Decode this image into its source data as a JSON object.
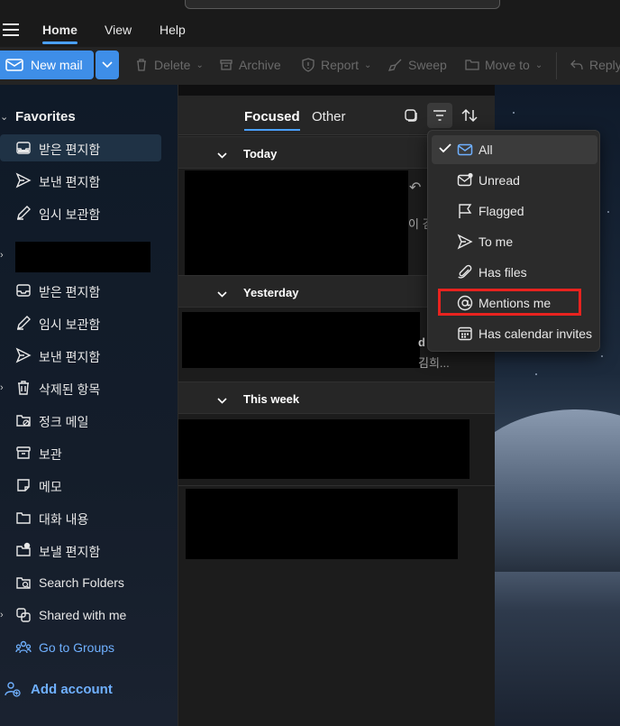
{
  "menubar": {
    "tabs": [
      {
        "label": "Home",
        "active": true
      },
      {
        "label": "View",
        "active": false
      },
      {
        "label": "Help",
        "active": false
      }
    ]
  },
  "toolbar": {
    "new_mail": "New mail",
    "delete": "Delete",
    "archive": "Archive",
    "report": "Report",
    "sweep": "Sweep",
    "move_to": "Move to",
    "reply": "Reply"
  },
  "sidebar": {
    "favorites_header": "Favorites",
    "favorites": [
      {
        "label": "받은 편지함",
        "icon": "inbox-icon",
        "selected": true
      },
      {
        "label": "보낸 편지함",
        "icon": "send-icon"
      },
      {
        "label": "임시 보관함",
        "icon": "draft-icon"
      }
    ],
    "account_folders": [
      {
        "label": "받은 편지함",
        "icon": "inbox-icon"
      },
      {
        "label": "임시 보관함",
        "icon": "draft-icon"
      },
      {
        "label": "보낸 편지함",
        "icon": "send-icon"
      },
      {
        "label": "삭제된 항목",
        "icon": "trash-icon"
      },
      {
        "label": "정크 메일",
        "icon": "junk-icon"
      },
      {
        "label": "보관",
        "icon": "archive-icon"
      },
      {
        "label": "메모",
        "icon": "note-icon"
      },
      {
        "label": "대화 내용",
        "icon": "folder-icon"
      },
      {
        "label": "보낼 편지함",
        "icon": "outbox-icon"
      },
      {
        "label": "Search Folders",
        "icon": "search-folder-icon"
      },
      {
        "label": "Shared with me",
        "icon": "shared-icon"
      },
      {
        "label": "Go to Groups",
        "icon": "groups-icon"
      }
    ],
    "add_account": "Add account"
  },
  "message_list": {
    "tab_focused": "Focused",
    "tab_other": "Other",
    "groups": [
      "Today",
      "Yesterday",
      "This week"
    ],
    "peek_today": "↶",
    "peek_today2": "이 김",
    "peek_yesterday": "d",
    "peek_yesterday2": "김희..."
  },
  "filter_menu": {
    "items": [
      {
        "label": "All",
        "icon": "mail-icon",
        "checked": true
      },
      {
        "label": "Unread",
        "icon": "unread-icon"
      },
      {
        "label": "Flagged",
        "icon": "flag-icon"
      },
      {
        "label": "To me",
        "icon": "send-icon"
      },
      {
        "label": "Has files",
        "icon": "attachment-icon"
      },
      {
        "label": "Mentions me",
        "icon": "mention-icon"
      },
      {
        "label": "Has calendar invites",
        "icon": "calendar-icon"
      }
    ]
  },
  "colors": {
    "accent": "#3e8ee8",
    "highlight": "#e8231f",
    "link": "#6fb0ff"
  }
}
